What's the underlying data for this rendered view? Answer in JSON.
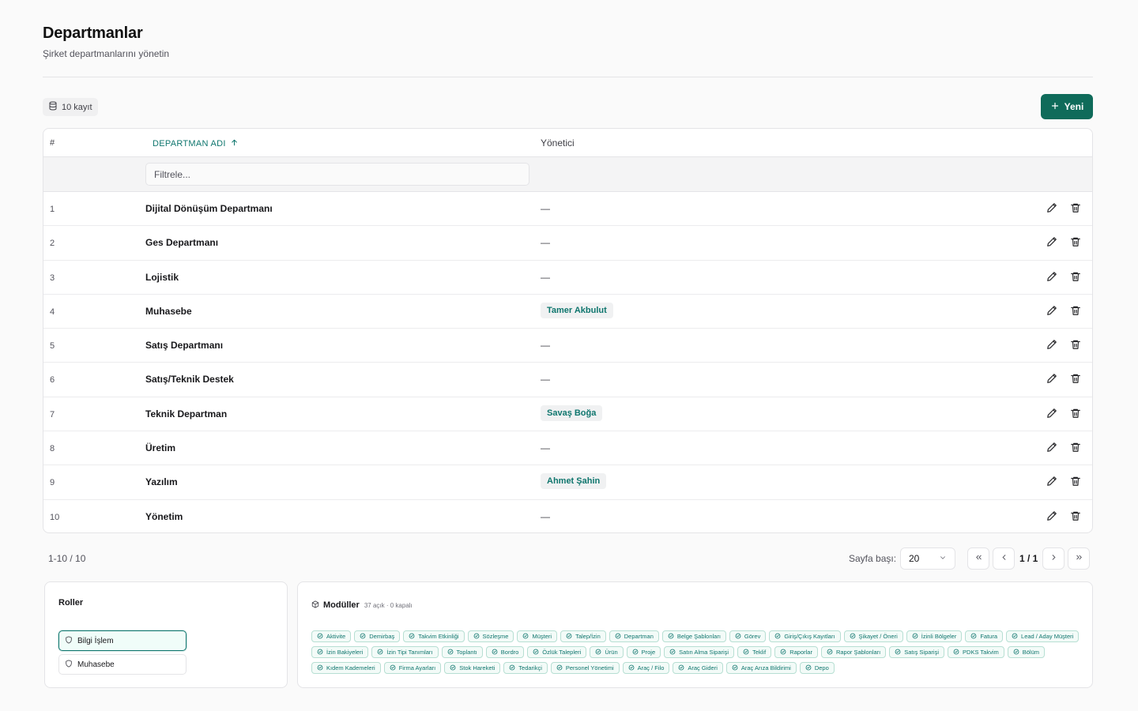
{
  "header": {
    "title": "Departmanlar",
    "subtitle": "Şirket departmanlarını yönetin"
  },
  "toolbar": {
    "record_count": "10 kayıt",
    "new_label": "Yeni"
  },
  "table": {
    "columns": {
      "num": "#",
      "name": "DEPARTMAN ADI",
      "manager": "Yönetici"
    },
    "filter_placeholder": "Filtrele...",
    "rows": [
      {
        "num": "1",
        "name": "Dijital Dönüşüm Departmanı",
        "manager": "—",
        "has_manager": false
      },
      {
        "num": "2",
        "name": "Ges Departmanı",
        "manager": "—",
        "has_manager": false
      },
      {
        "num": "3",
        "name": "Lojistik",
        "manager": "—",
        "has_manager": false
      },
      {
        "num": "4",
        "name": "Muhasebe",
        "manager": "Tamer Akbulut",
        "has_manager": true
      },
      {
        "num": "5",
        "name": "Satış Departmanı",
        "manager": "—",
        "has_manager": false
      },
      {
        "num": "6",
        "name": "Satış/Teknik Destek",
        "manager": "—",
        "has_manager": false
      },
      {
        "num": "7",
        "name": "Teknik Departman",
        "manager": "Savaş Boğa",
        "has_manager": true
      },
      {
        "num": "8",
        "name": "Üretim",
        "manager": "—",
        "has_manager": false
      },
      {
        "num": "9",
        "name": "Yazılım",
        "manager": "Ahmet Şahin",
        "has_manager": true
      },
      {
        "num": "10",
        "name": "Yönetim",
        "manager": "—",
        "has_manager": false
      }
    ]
  },
  "pagination": {
    "range_text": "1-10 / 10",
    "per_page_label": "Sayfa başı:",
    "per_page_value": "20",
    "page_info": "1 / 1"
  },
  "roles": {
    "title": "Roller",
    "items": [
      {
        "label": "Bilgi İşlem",
        "active": true
      },
      {
        "label": "Muhasebe",
        "active": false
      }
    ]
  },
  "modules": {
    "title": "Modüller",
    "summary": "37 açık · 0 kapalı",
    "items": [
      "Aktivite",
      "Demirbaş",
      "Takvim Etkinliği",
      "Sözleşme",
      "Müşteri",
      "Talep/İzin",
      "Departman",
      "Belge Şablonları",
      "Görev",
      "Giriş/Çıkış Kayıtları",
      "Şikayet / Öneri",
      "İzinli Bölgeler",
      "Fatura",
      "Lead / Aday Müşteri",
      "İzin Bakiyeleri",
      "İzin Tipi Tanımları",
      "Toplantı",
      "Bordro",
      "Özlük Talepleri",
      "Ürün",
      "Proje",
      "Satın Alma Siparişi",
      "Teklif",
      "Raporlar",
      "Rapor Şablonları",
      "Satış Siparişi",
      "PDKS Takvim",
      "Bölüm",
      "Kıdem Kademeleri",
      "Firma Ayarları",
      "Stok Hareketi",
      "Tedarikçi",
      "Personel Yönetimi",
      "Araç / Filo",
      "Araç Gideri",
      "Araç Arıza Bildirimi",
      "Depo"
    ]
  },
  "colors": {
    "accent": "#0f6b5a",
    "accent_text": "#0f766e",
    "chip_border": "#b7dfd3",
    "chip_bg": "#f3fbf8"
  },
  "icons": {
    "record_count": "database-icon",
    "new": "plus-icon",
    "sort": "arrow-up-icon",
    "edit": "pencil-icon",
    "delete": "trash-icon",
    "role": "shield-icon",
    "modules": "box-icon",
    "module_chip": "check-circle-icon"
  }
}
